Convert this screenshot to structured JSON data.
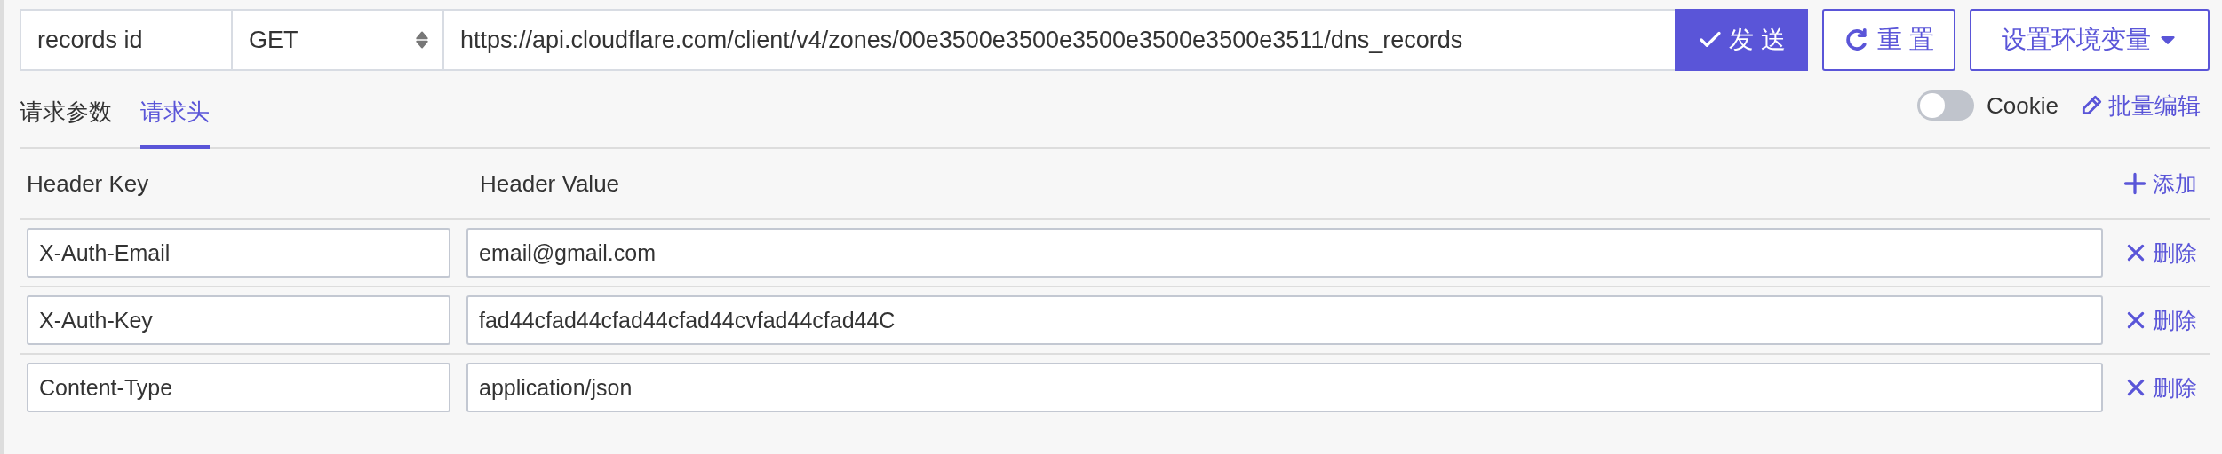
{
  "request_bar": {
    "name": {
      "value": "records id"
    },
    "method": {
      "value": "GET"
    },
    "url": {
      "value": "https://api.cloudflare.com/client/v4/zones/00e3500e3500e3500e3500e3500e3511/dns_records"
    },
    "send_button": "发 送",
    "reset_button": "重 置",
    "env_button": "设置环境变量"
  },
  "tabs": [
    {
      "label": "请求参数",
      "selected": false
    },
    {
      "label": "请求头",
      "selected": true
    }
  ],
  "cookie_toggle": {
    "label": "Cookie",
    "on": false
  },
  "bulk_edit": "批量编辑",
  "table": {
    "columns": [
      "Header Key",
      "Header Value"
    ],
    "add_button": "添加",
    "rows": [
      {
        "key": "X-Auth-Email",
        "value": "email@gmail.com",
        "delete": "删除"
      },
      {
        "key": "X-Auth-Key",
        "value": "fad44cfad44cfad44cfad44cvfad44cfad44C",
        "delete": "删除"
      },
      {
        "key": "Content-Type",
        "value": "application/json",
        "delete": "删除"
      }
    ]
  }
}
